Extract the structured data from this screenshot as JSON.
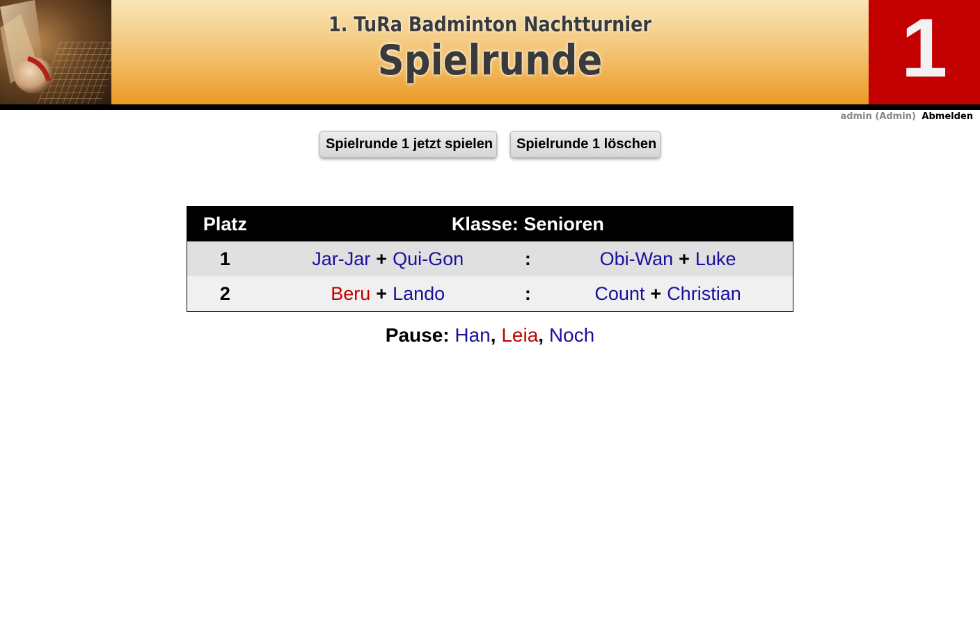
{
  "header": {
    "event_title": "1. TuRa Badminton Nachtturnier",
    "page_title": "Spielrunde",
    "round_number": "1",
    "colors": {
      "gradient_top": "#f8e6b8",
      "gradient_bottom": "#ec9a24",
      "round_box": "#c20000"
    }
  },
  "user": {
    "name": "admin (Admin)",
    "logout_label": "Abmelden"
  },
  "actions": {
    "play_label": "Spielrunde 1 jetzt spielen",
    "delete_label": "Spielrunde 1 löschen"
  },
  "table": {
    "col_platz": "Platz",
    "col_klasse": "Klasse: Senioren",
    "rows": [
      {
        "platz": "1",
        "team1": [
          {
            "name": "Jar-Jar",
            "color": "#1a0f9c"
          },
          {
            "name": "Qui-Gon",
            "color": "#1a0f9c"
          }
        ],
        "separator": ":",
        "team2": [
          {
            "name": "Obi-Wan",
            "color": "#1a0f9c"
          },
          {
            "name": "Luke",
            "color": "#1a0f9c"
          }
        ]
      },
      {
        "platz": "2",
        "team1": [
          {
            "name": "Beru",
            "color": "#c00000"
          },
          {
            "name": "Lando",
            "color": "#1a0f9c"
          }
        ],
        "separator": ":",
        "team2": [
          {
            "name": "Count",
            "color": "#1a0f9c"
          },
          {
            "name": "Christian",
            "color": "#1a0f9c"
          }
        ]
      }
    ],
    "plus": "+"
  },
  "pause": {
    "label": "Pause:",
    "players": [
      {
        "name": "Han",
        "color": "#1a0f9c"
      },
      {
        "name": "Leia",
        "color": "#c00000"
      },
      {
        "name": "Noch",
        "color": "#1a0f9c"
      }
    ],
    "separator": ","
  }
}
